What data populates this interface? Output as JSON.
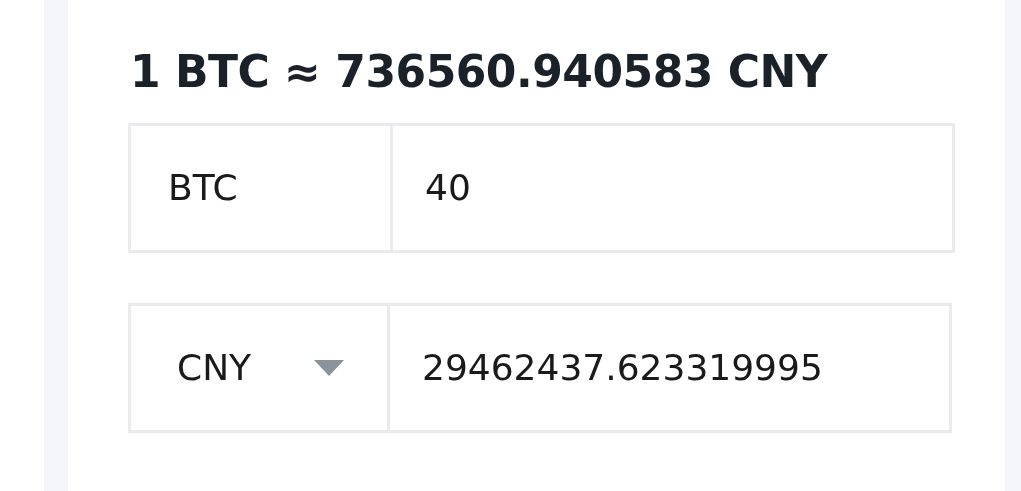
{
  "rate_title": "1 BTC ≈ 736560.940583 CNY",
  "rows": [
    {
      "kind": "fixed",
      "currency": "BTC",
      "amount": "40"
    },
    {
      "kind": "dropdown",
      "currency": "CNY",
      "amount": "29462437.623319995"
    }
  ]
}
